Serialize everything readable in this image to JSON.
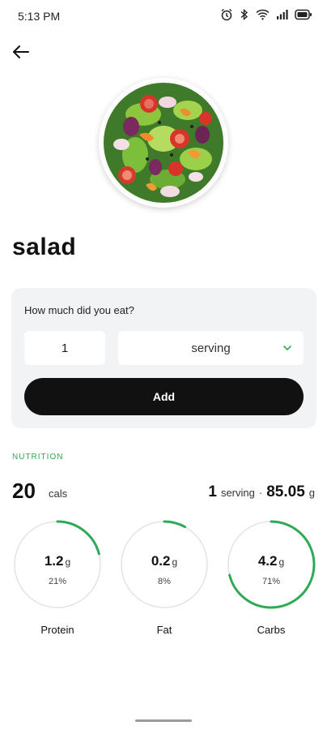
{
  "status_bar": {
    "time": "5:13 PM"
  },
  "food": {
    "title": "salad"
  },
  "portion": {
    "question": "How much did you eat?",
    "quantity": "1",
    "unit": "serving",
    "add_label": "Add"
  },
  "nutrition": {
    "section_label": "NUTRITION",
    "calories": "20",
    "calories_unit": "cals",
    "serving_count": "1",
    "serving_unit": "serving",
    "separator": "·",
    "weight": "85.05",
    "weight_unit": "g",
    "macros": [
      {
        "name": "Protein",
        "value": "1.2",
        "unit": "g",
        "percent_label": "21%",
        "percent": 0.21
      },
      {
        "name": "Fat",
        "value": "0.2",
        "unit": "g",
        "percent_label": "8%",
        "percent": 0.08
      },
      {
        "name": "Carbs",
        "value": "4.2",
        "unit": "g",
        "percent_label": "71%",
        "percent": 0.71
      }
    ]
  },
  "colors": {
    "accent": "#2eaa54",
    "button": "#111111",
    "card": "#f1f3f4"
  }
}
